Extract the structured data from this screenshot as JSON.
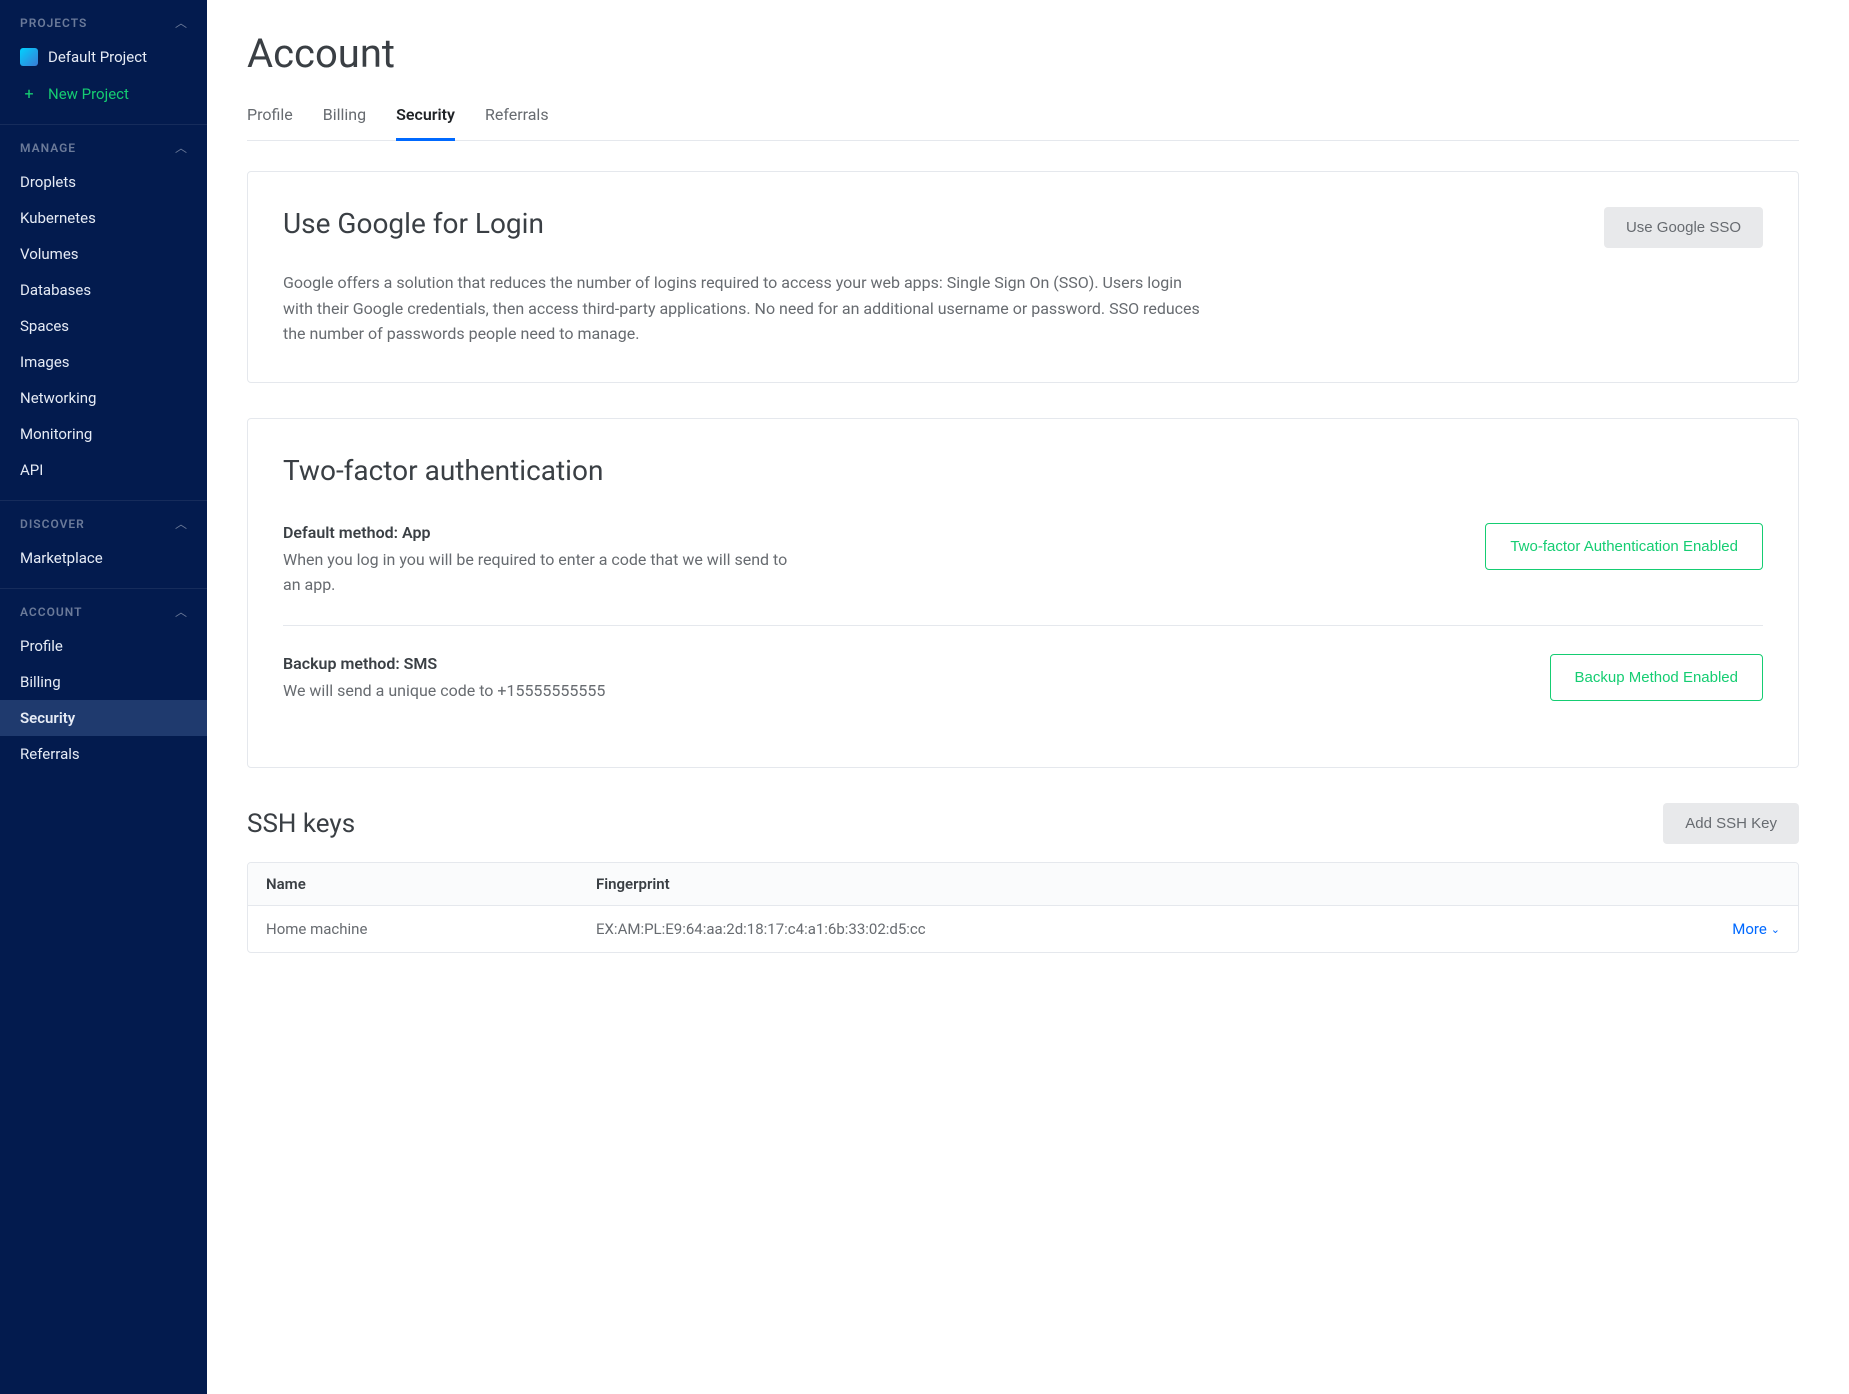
{
  "sidebar": {
    "sections": [
      {
        "id": "projects",
        "label": "PROJECTS",
        "items": [
          {
            "id": "default-project",
            "label": "Default Project",
            "icon": "project"
          },
          {
            "id": "new-project",
            "label": "New Project",
            "icon": "plus",
            "accent": true
          }
        ]
      },
      {
        "id": "manage",
        "label": "MANAGE",
        "items": [
          {
            "id": "droplets",
            "label": "Droplets"
          },
          {
            "id": "kubernetes",
            "label": "Kubernetes"
          },
          {
            "id": "volumes",
            "label": "Volumes"
          },
          {
            "id": "databases",
            "label": "Databases"
          },
          {
            "id": "spaces",
            "label": "Spaces"
          },
          {
            "id": "images",
            "label": "Images"
          },
          {
            "id": "networking",
            "label": "Networking"
          },
          {
            "id": "monitoring",
            "label": "Monitoring"
          },
          {
            "id": "api",
            "label": "API"
          }
        ]
      },
      {
        "id": "discover",
        "label": "DISCOVER",
        "items": [
          {
            "id": "marketplace",
            "label": "Marketplace"
          }
        ]
      },
      {
        "id": "account",
        "label": "ACCOUNT",
        "items": [
          {
            "id": "profile",
            "label": "Profile"
          },
          {
            "id": "billing",
            "label": "Billing"
          },
          {
            "id": "security",
            "label": "Security",
            "active": true
          },
          {
            "id": "referrals",
            "label": "Referrals"
          }
        ]
      }
    ]
  },
  "page": {
    "title": "Account",
    "tabs": [
      {
        "id": "profile",
        "label": "Profile"
      },
      {
        "id": "billing",
        "label": "Billing"
      },
      {
        "id": "security",
        "label": "Security",
        "active": true
      },
      {
        "id": "referrals",
        "label": "Referrals"
      }
    ]
  },
  "sso": {
    "title": "Use Google for Login",
    "button": "Use Google SSO",
    "desc": "Google offers a solution that reduces the number of logins required to access your web apps: Single Sign On (SSO). Users login with their Google credentials, then access third-party applications. No need for an additional username or password. SSO reduces the number of passwords people need to manage."
  },
  "tfa": {
    "title": "Two-factor authentication",
    "default_label": "Default method: App",
    "default_desc": "When you log in you will be required to enter a code that we will send to an app.",
    "default_button": "Two-factor Authentication Enabled",
    "backup_label": "Backup method: SMS",
    "backup_desc": "We will send a unique code to +15555555555",
    "backup_button": "Backup Method Enabled"
  },
  "ssh": {
    "title": "SSH keys",
    "add_button": "Add SSH Key",
    "col_name": "Name",
    "col_fingerprint": "Fingerprint",
    "more_label": "More",
    "rows": [
      {
        "name": "Home machine",
        "fingerprint": "EX:AM:PL:E9:64:aa:2d:18:17:c4:a1:6b:33:02:d5:cc"
      }
    ]
  }
}
